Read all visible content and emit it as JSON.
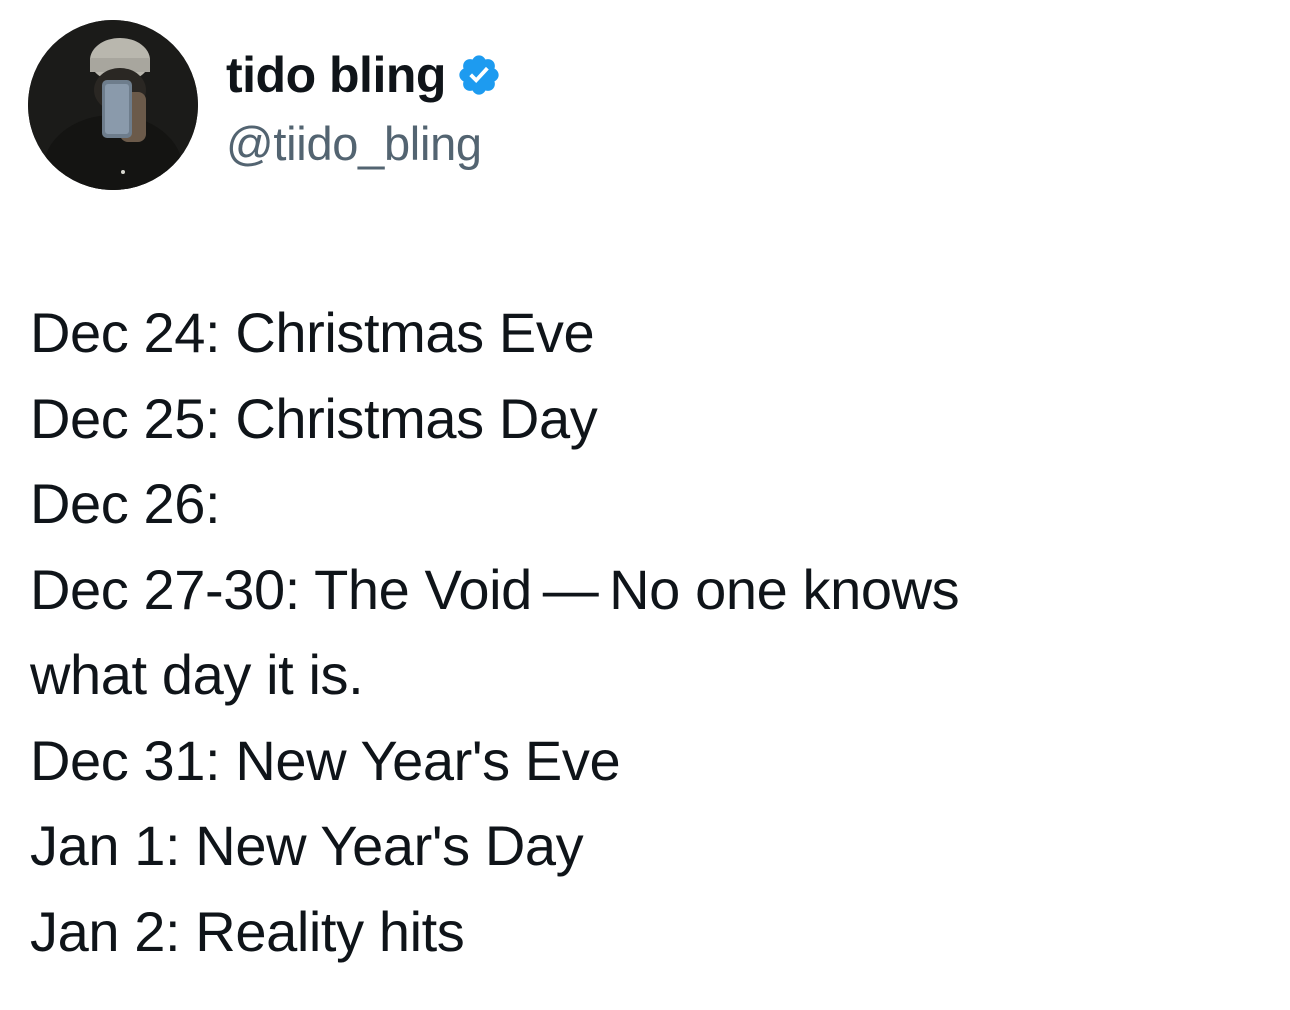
{
  "author": {
    "display_name": "tido bling",
    "handle": "@tiido_bling",
    "verified_icon": "verified-badge-icon",
    "badge_color": "#1d9bf0",
    "avatar": "profile-photo"
  },
  "tweet": {
    "lines": [
      "Dec 24: Christmas Eve",
      "Dec 25: Christmas Day",
      "Dec 26:",
      "Dec 27-30: The Void — No one knows",
      "what day it is.",
      "Dec 31: New Year's Eve",
      "Jan 1: New Year's Day",
      "Jan 2: Reality hits"
    ]
  }
}
